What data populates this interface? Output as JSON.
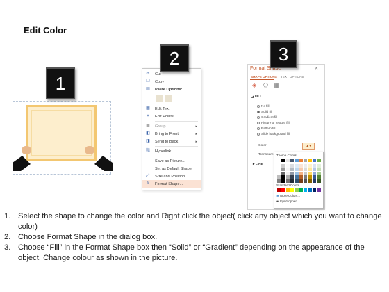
{
  "title": "Edit Color",
  "badges": [
    "1",
    "2",
    "3"
  ],
  "context_menu": {
    "items": [
      {
        "label": "Cut",
        "icon": "scissors-icon",
        "submenu": false,
        "disabled": false
      },
      {
        "label": "Copy",
        "icon": "copy-icon",
        "submenu": false,
        "disabled": false
      },
      {
        "label": "Paste Options:",
        "icon": "paste-icon",
        "submenu": false,
        "disabled": false
      },
      {
        "label": "Edit Text",
        "icon": "edit-text-icon",
        "submenu": false,
        "disabled": false
      },
      {
        "label": "Edit Points",
        "icon": "edit-points-icon",
        "submenu": false,
        "disabled": false
      },
      {
        "label": "Group",
        "icon": "group-icon",
        "submenu": true,
        "disabled": true
      },
      {
        "label": "Bring to Front",
        "icon": "bring-to-front-icon",
        "submenu": true,
        "disabled": false
      },
      {
        "label": "Send to Back",
        "icon": "send-to-back-icon",
        "submenu": true,
        "disabled": false
      },
      {
        "label": "Hyperlink...",
        "icon": "hyperlink-icon",
        "submenu": false,
        "disabled": false
      },
      {
        "label": "Save as Picture...",
        "icon": "",
        "submenu": false,
        "disabled": false
      },
      {
        "label": "Set as Default Shape",
        "icon": "",
        "submenu": false,
        "disabled": false
      },
      {
        "label": "Size and Position...",
        "icon": "size-position-icon",
        "submenu": false,
        "disabled": false
      },
      {
        "label": "Format Shape...",
        "icon": "format-shape-icon",
        "submenu": false,
        "disabled": false,
        "highlighted": true
      }
    ]
  },
  "format_pane": {
    "title": "Format Shape",
    "tabs": [
      "SHAPE OPTIONS",
      "TEXT OPTIONS"
    ],
    "sections": {
      "fill": "FILL",
      "line": "LINE"
    },
    "fill_options": [
      "No fill",
      "Solid fill",
      "Gradient fill",
      "Picture or texture fill",
      "Pattern fill",
      "Slide background fill"
    ],
    "selected_fill": "Solid fill",
    "color_label": "Color",
    "transparency_label": "Transparency",
    "palette": {
      "theme_label": "Theme Colors",
      "standard_label": "Standard Colors",
      "more_colors": "More Colors...",
      "eyedropper": "Eyedropper"
    }
  },
  "theme_colors": [
    "#ffffff",
    "#000000",
    "#e7e6e6",
    "#44546a",
    "#5b9bd5",
    "#ed7d31",
    "#a5a5a5",
    "#ffc000",
    "#4472c4",
    "#70ad47"
  ],
  "standard_colors": [
    "#c00000",
    "#ff0000",
    "#ffc000",
    "#ffff00",
    "#92d050",
    "#00b050",
    "#00b0f0",
    "#0070c0",
    "#002060",
    "#7030a0"
  ],
  "instructions": [
    {
      "num": "1.",
      "text": "Select the shape to change the color and Right click the object( click any object which you want to change color)"
    },
    {
      "num": "2.",
      "text": "Choose Format Shape in the dialog box."
    },
    {
      "num": "3.",
      "text": "Choose “Fill” in the Format Shape box then “Solid” or “Gradient” depending on the appearance of the object. Change colour as shown in the picture."
    }
  ]
}
